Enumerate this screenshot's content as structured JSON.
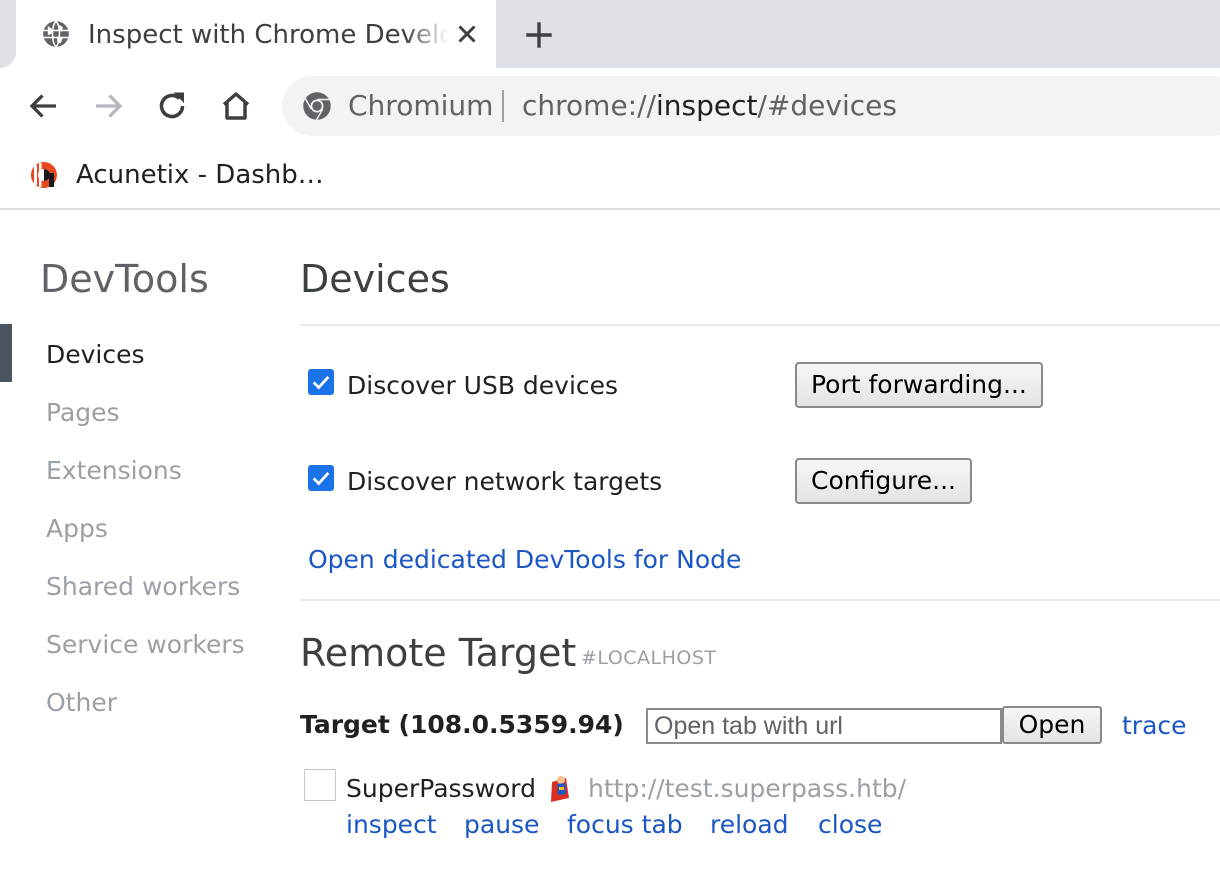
{
  "tab": {
    "title": "Inspect with Chrome Developer Tools",
    "favicon": "globe-icon"
  },
  "toolbar": {
    "back": "back-arrow-icon",
    "forward": "forward-arrow-icon",
    "reload": "reload-icon",
    "home": "home-icon"
  },
  "omnibox": {
    "origin_label": "Chromium",
    "url_scheme": "chrome://",
    "url_host": "inspect",
    "url_path": "/#devices"
  },
  "bookmarks": [
    {
      "label": "Acunetix - Dashb…",
      "icon": "acunetix-icon"
    }
  ],
  "sidebar": {
    "title": "DevTools",
    "items": [
      {
        "label": "Devices",
        "active": true
      },
      {
        "label": "Pages"
      },
      {
        "label": "Extensions"
      },
      {
        "label": "Apps"
      },
      {
        "label": "Shared workers"
      },
      {
        "label": "Service workers"
      },
      {
        "label": "Other"
      }
    ]
  },
  "main": {
    "title": "Devices",
    "usb": {
      "label": "Discover USB devices",
      "checked": true,
      "button": "Port forwarding..."
    },
    "network": {
      "label": "Discover network targets",
      "checked": true,
      "button": "Configure..."
    },
    "node_link": "Open dedicated DevTools for Node",
    "remote": {
      "title": "Remote Target",
      "subtitle": "#LOCALHOST",
      "target_name": "Target (108.0.5359.94)",
      "url_placeholder": "Open tab with url",
      "open_button": "Open",
      "trace_link": "trace",
      "page": {
        "name": "SuperPassword",
        "url": "http://test.superpass.htb/",
        "actions": [
          "inspect",
          "pause",
          "focus tab",
          "reload",
          "close"
        ]
      }
    }
  },
  "colors": {
    "link": "#1a56c5",
    "checkbox": "#1a73e8",
    "tabstrip": "#dee1e6"
  }
}
